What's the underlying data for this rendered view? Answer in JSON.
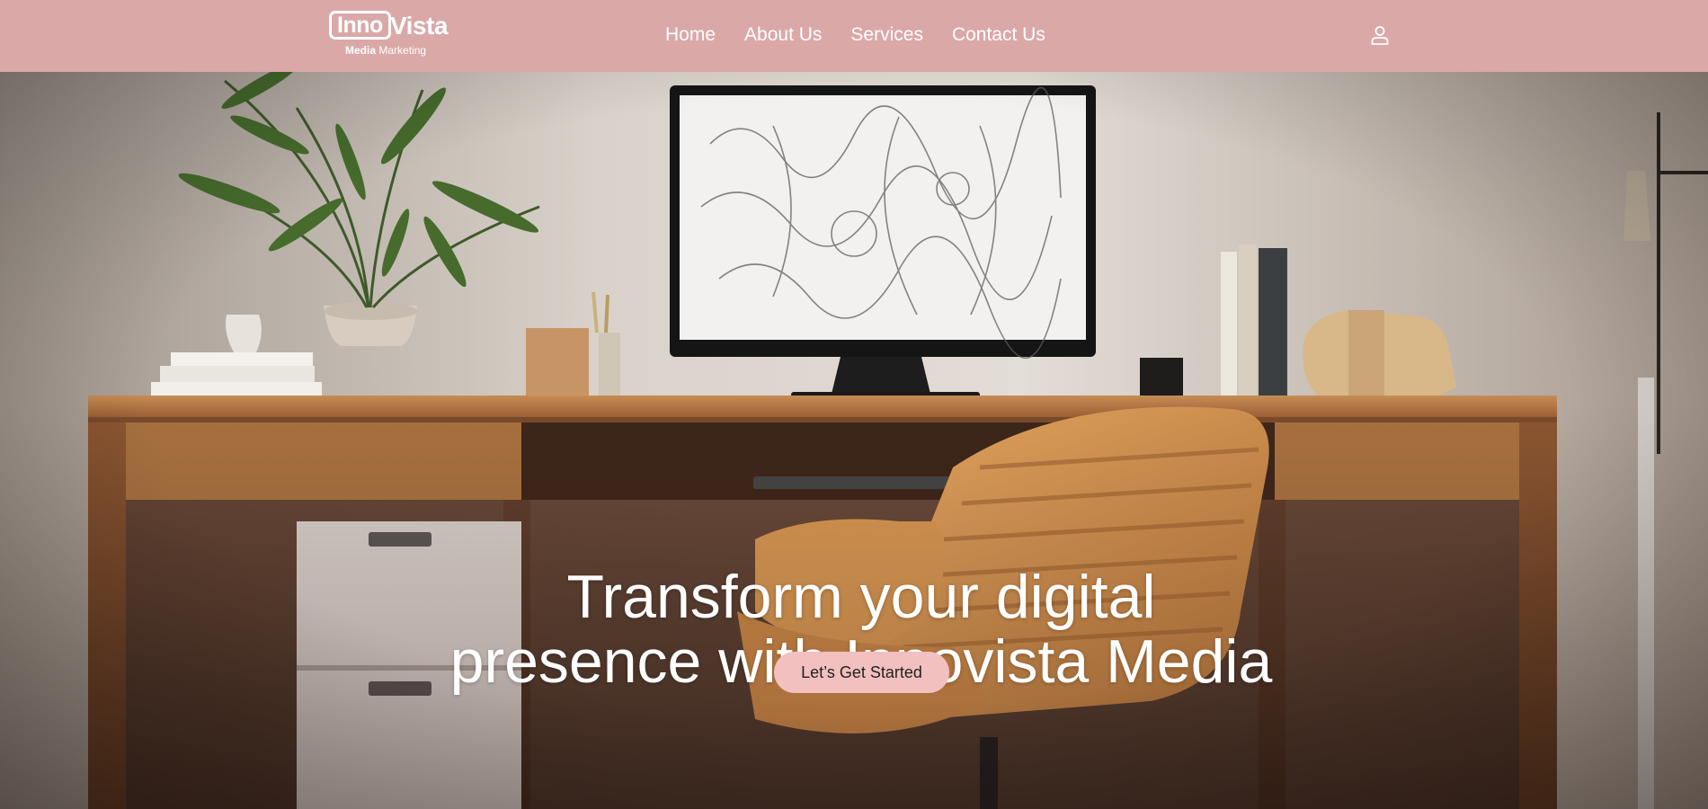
{
  "brand": {
    "logo_primary": "Inno",
    "logo_secondary": "Vista",
    "tagline_bold": "Media",
    "tagline_rest": " Marketing"
  },
  "nav": {
    "items": [
      {
        "label": "Home"
      },
      {
        "label": "About Us"
      },
      {
        "label": "Services"
      },
      {
        "label": "Contact Us"
      }
    ],
    "account_icon": "user-icon"
  },
  "hero": {
    "title_line1": "Transform your digital",
    "title_line2": "presence with Innovista Media",
    "cta_label": "Let’s Get Started",
    "background_image": "home-office-desk-photo"
  },
  "colors": {
    "header_bg": "#dba8a8",
    "cta_bg": "#f2c0bf",
    "text_light": "#ffffff"
  }
}
